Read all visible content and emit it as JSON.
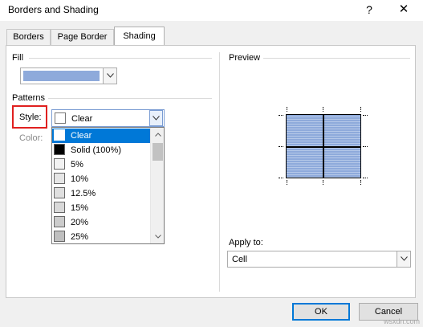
{
  "window": {
    "title": "Borders and Shading",
    "help_glyph": "?",
    "close_glyph": "✕"
  },
  "tabs": [
    {
      "label": "Borders",
      "active": false
    },
    {
      "label": "Page Border",
      "active": false
    },
    {
      "label": "Shading",
      "active": true
    }
  ],
  "fill": {
    "label": "Fill",
    "selected_color": "#8eaadb"
  },
  "patterns": {
    "label": "Patterns",
    "style_label": "Style:",
    "style_value": "Clear",
    "color_label": "Color:",
    "style_options": [
      {
        "label": "Clear",
        "swatch": "#ffffff"
      },
      {
        "label": "Solid (100%)",
        "swatch": "#000000"
      },
      {
        "label": "5%",
        "swatch": "#f2f2f2"
      },
      {
        "label": "10%",
        "swatch": "#e6e6e6"
      },
      {
        "label": "12.5%",
        "swatch": "#dfdfdf"
      },
      {
        "label": "15%",
        "swatch": "#d9d9d9"
      },
      {
        "label": "20%",
        "swatch": "#cccccc"
      },
      {
        "label": "25%",
        "swatch": "#bfbfbf"
      }
    ]
  },
  "preview": {
    "label": "Preview",
    "fill_color": "#8eaadb"
  },
  "apply_to": {
    "label": "Apply to:",
    "value": "Cell"
  },
  "buttons": {
    "ok": "OK",
    "cancel": "Cancel"
  },
  "watermark": "wsxdn.com",
  "colors": {
    "accent": "#0078d7",
    "highlight_box": "#e0201f"
  }
}
